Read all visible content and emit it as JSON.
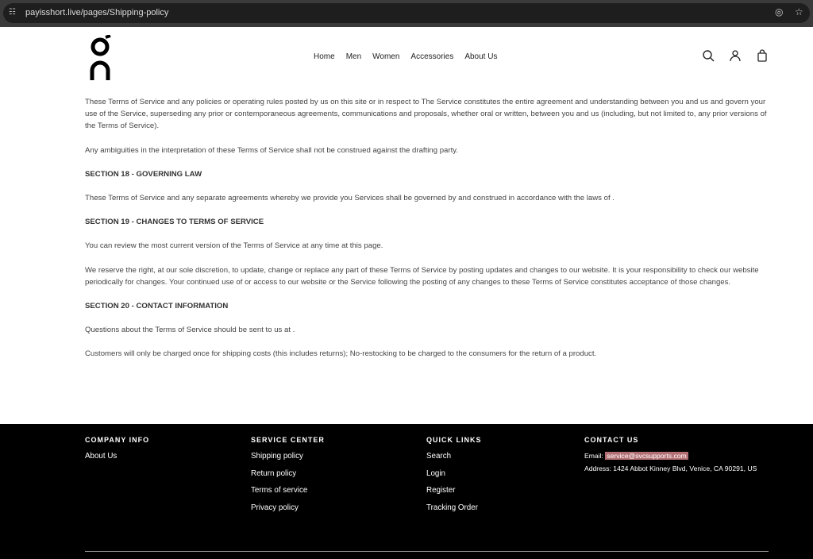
{
  "browser": {
    "url": "payisshort.live/pages/Shipping-policy"
  },
  "header": {
    "nav": [
      "Home",
      "Men",
      "Women",
      "Accessories",
      "About Us"
    ]
  },
  "content": {
    "p1": "These Terms of Service and any policies or operating rules posted by us on this site or in respect to The Service constitutes the entire agreement and understanding between you and us and govern your use of the Service, superseding any prior or contemporaneous agreements, communications and proposals, whether oral or written, between you and us (including, but not limited to, any prior versions of the Terms of Service).",
    "p2": "Any ambiguities in the interpretation of these Terms of Service shall not be construed against the drafting party.",
    "h18": "SECTION 18 - GOVERNING LAW",
    "p3": "These Terms of Service and any separate agreements whereby we provide you Services shall be governed by and construed in accordance with the laws of .",
    "h19": "SECTION 19 - CHANGES TO TERMS OF SERVICE",
    "p4": "You can review the most current version of the Terms of Service at any time at this page.",
    "p5": "We reserve the right, at our sole discretion, to update, change or replace any part of these Terms of Service by posting updates and changes to our website. It is your responsibility to check our website periodically for changes. Your continued use of or access to our website or the Service following the posting of any changes to these Terms of Service constitutes acceptance of those changes.",
    "h20": "SECTION 20 - CONTACT INFORMATION",
    "p6": "Questions about the Terms of Service should be sent to us at .",
    "p7": "Customers will only be charged once for shipping costs (this includes returns); No-restocking to be charged to the consumers for the return of a product."
  },
  "footer": {
    "company": {
      "title": "COMPANY INFO",
      "links": [
        "About Us"
      ]
    },
    "service": {
      "title": "SERVICE CENTER",
      "links": [
        "Shipping policy",
        "Return policy",
        "Terms of service",
        "Privacy policy"
      ]
    },
    "quick": {
      "title": "QUICK LINKS",
      "links": [
        "Search",
        "Login",
        "Register",
        "Tracking Order"
      ]
    },
    "contact": {
      "title": "CONTACT US",
      "email_label": "Email:",
      "email": "service@svcsupports.com",
      "address": "Address: 1424 Abbot Kinney Blvd, Venice, CA 90291, US"
    }
  }
}
